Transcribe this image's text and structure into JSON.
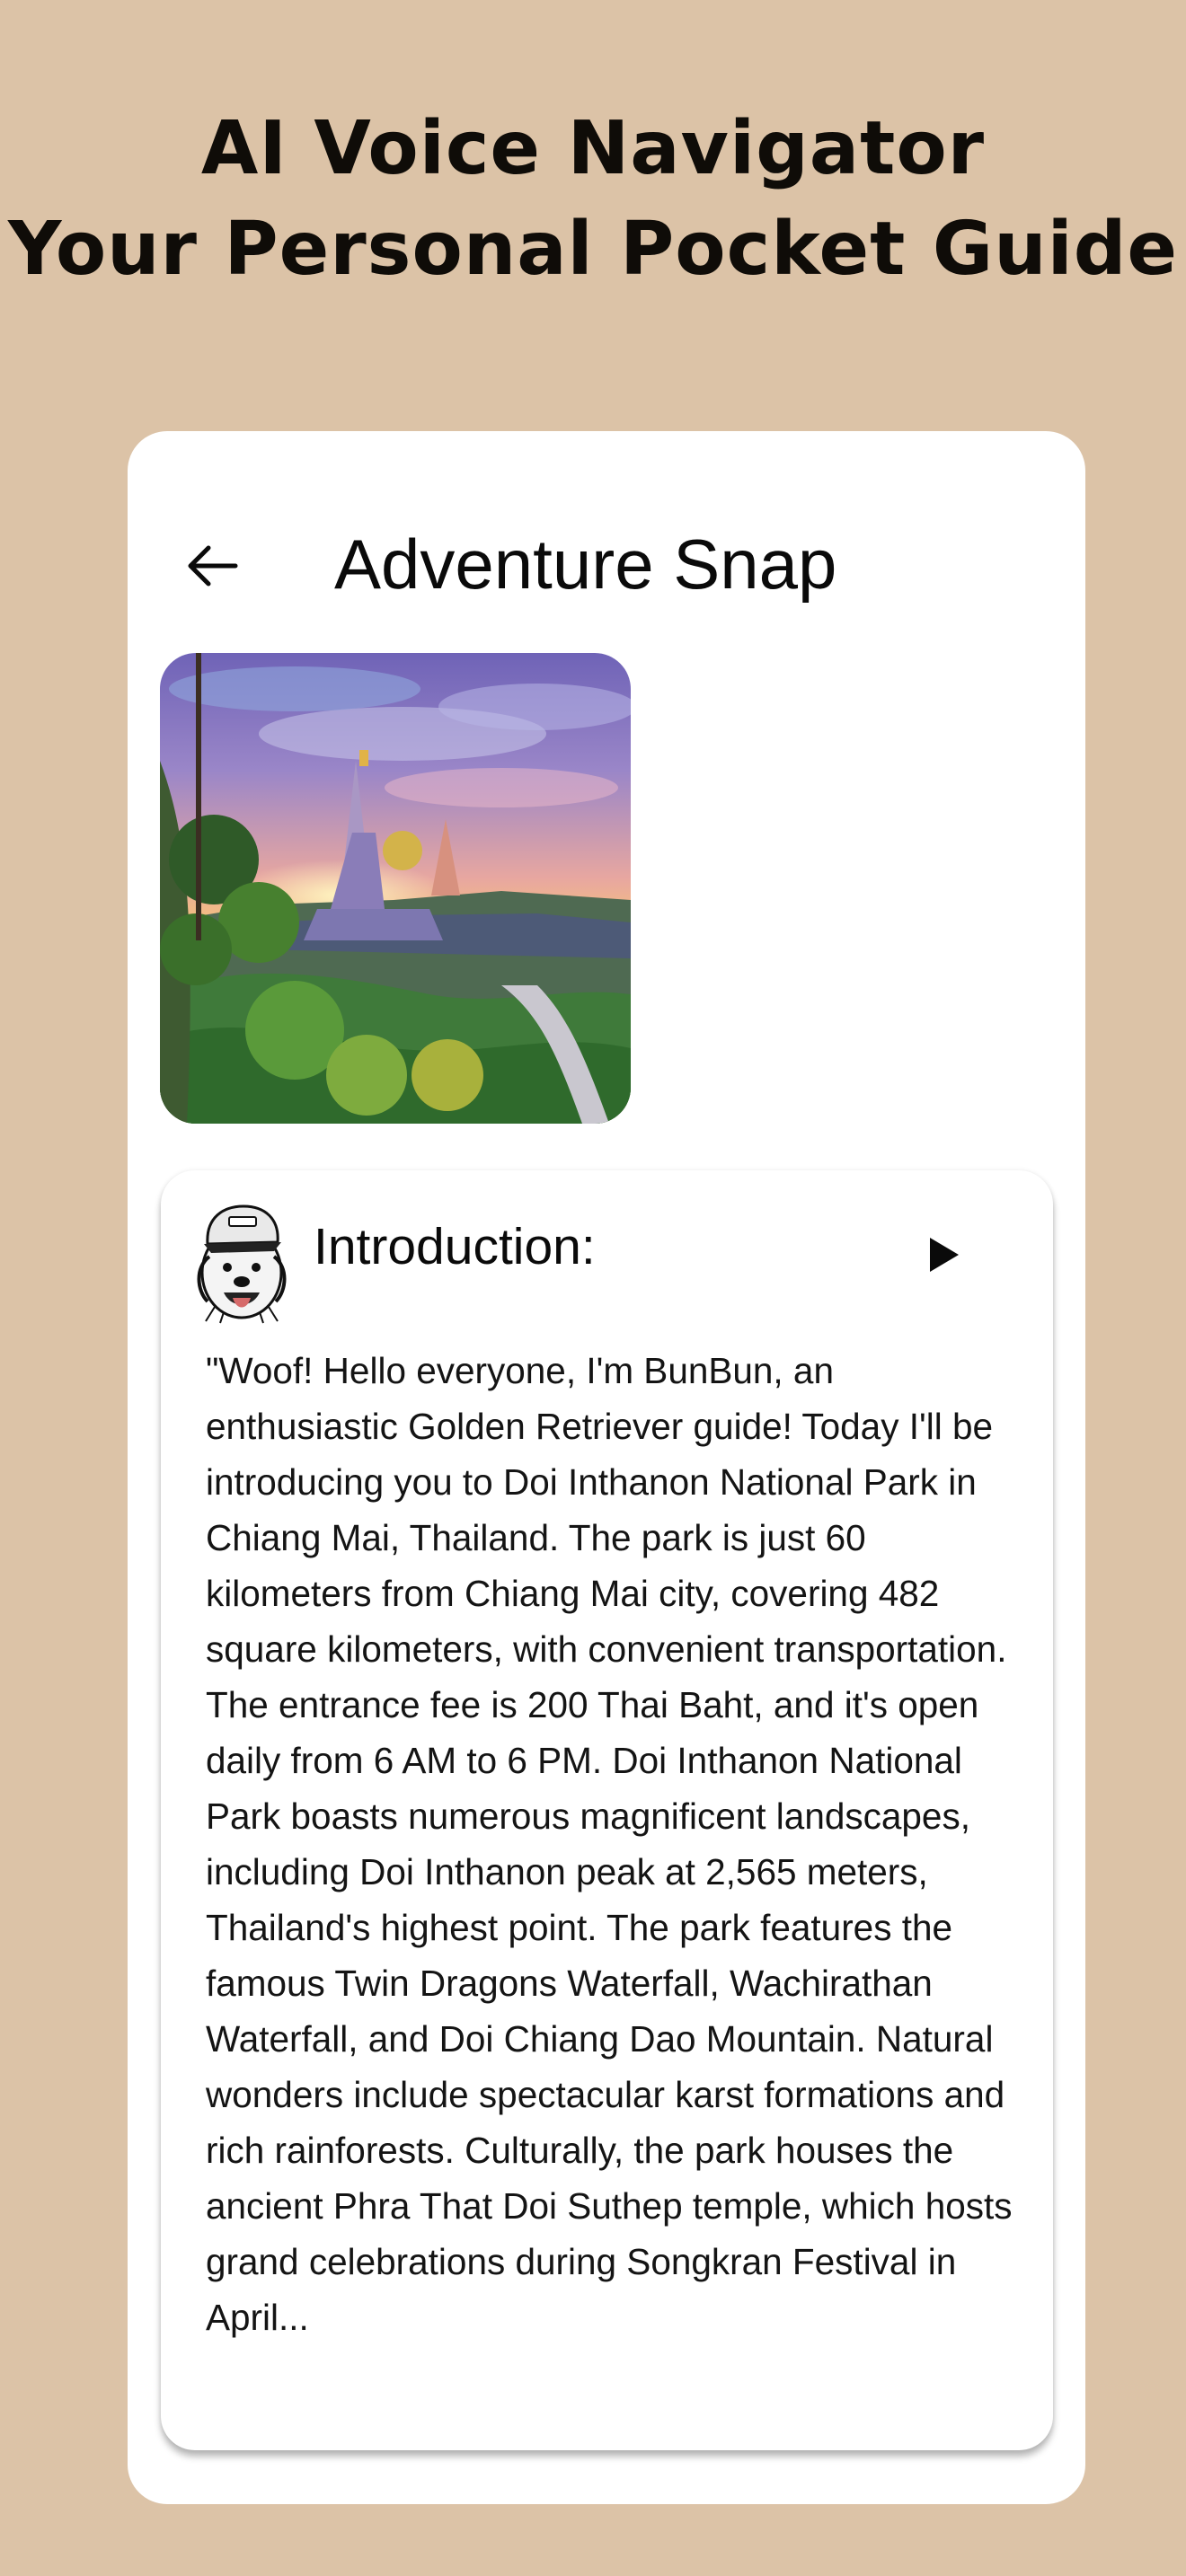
{
  "hero": {
    "line1": "AI Voice Navigator",
    "line2": "Your Personal Pocket Guide"
  },
  "screen": {
    "back_icon": "arrow-left-icon",
    "title": "Adventure Snap",
    "photo_icon": "temple-landscape-photo"
  },
  "intro": {
    "avatar_icon": "dog-guide-avatar",
    "heading": "Introduction:",
    "play_icon": "play-icon",
    "text": "\"Woof! Hello everyone, I'm BunBun, an enthusiastic Golden Retriever guide! Today I'll be introducing you to Doi Inthanon National Park in Chiang Mai, Thailand. The park is just 60 kilometers from Chiang Mai city, covering 482 square kilometers, with convenient transportation. The entrance fee is 200 Thai Baht, and it's open daily from 6 AM to 6 PM. Doi Inthanon National Park boasts numerous magnificent landscapes, including Doi Inthanon peak at 2,565 meters, Thailand's highest point. The park features the famous Twin Dragons Waterfall, Wachirathan Waterfall, and Doi Chiang Dao Mountain. Natural wonders include spectacular karst formations and rich rainforests. Culturally, the park houses the ancient Phra That Doi Suthep temple, which hosts grand celebrations during Songkran Festival in April..."
  },
  "colors": {
    "background": "#dcc3a7",
    "card": "#ffffff",
    "text": "#0a0a0a"
  }
}
